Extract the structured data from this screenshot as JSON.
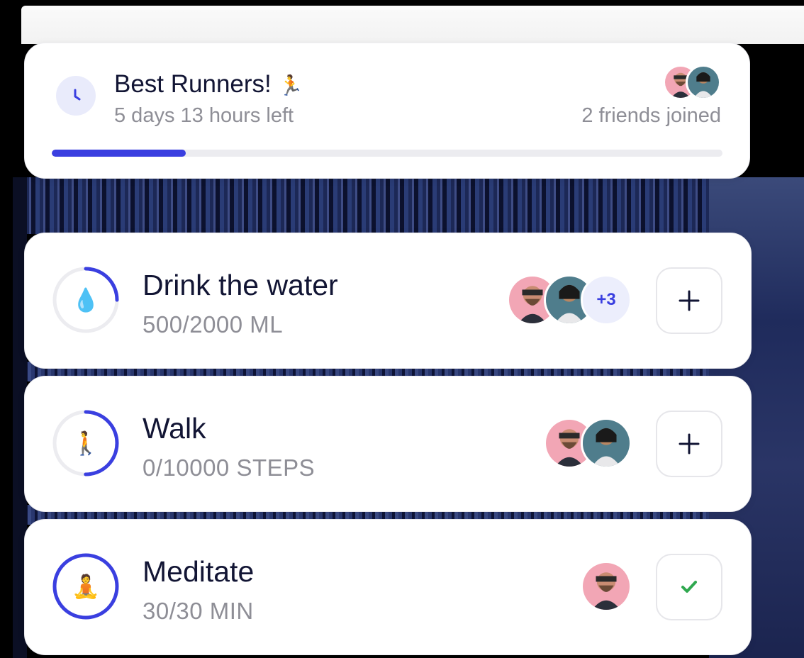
{
  "challenge": {
    "title": "Best Runners!",
    "title_emoji": "🏃",
    "time_left": "5 days 13 hours left",
    "friends_joined": "2 friends joined",
    "progress": 0.2,
    "icon": "clock-icon",
    "accent_color": "#3a3fe0"
  },
  "habits": [
    {
      "title": "Drink the water",
      "value": "500/2000 ML",
      "emoji": "💧",
      "progress": 0.25,
      "extra_count": "+3",
      "action": "add",
      "action_icon": "plus-icon"
    },
    {
      "title": "Walk",
      "value": "0/10000 STEPS",
      "emoji": "🚶",
      "progress": 0.5,
      "action": "add",
      "action_icon": "plus-icon"
    },
    {
      "title": "Meditate",
      "value": "30/30 MIN",
      "emoji": "🧘",
      "progress": 1.0,
      "action": "done",
      "action_icon": "check-icon",
      "check_color": "#2fa84f"
    }
  ]
}
